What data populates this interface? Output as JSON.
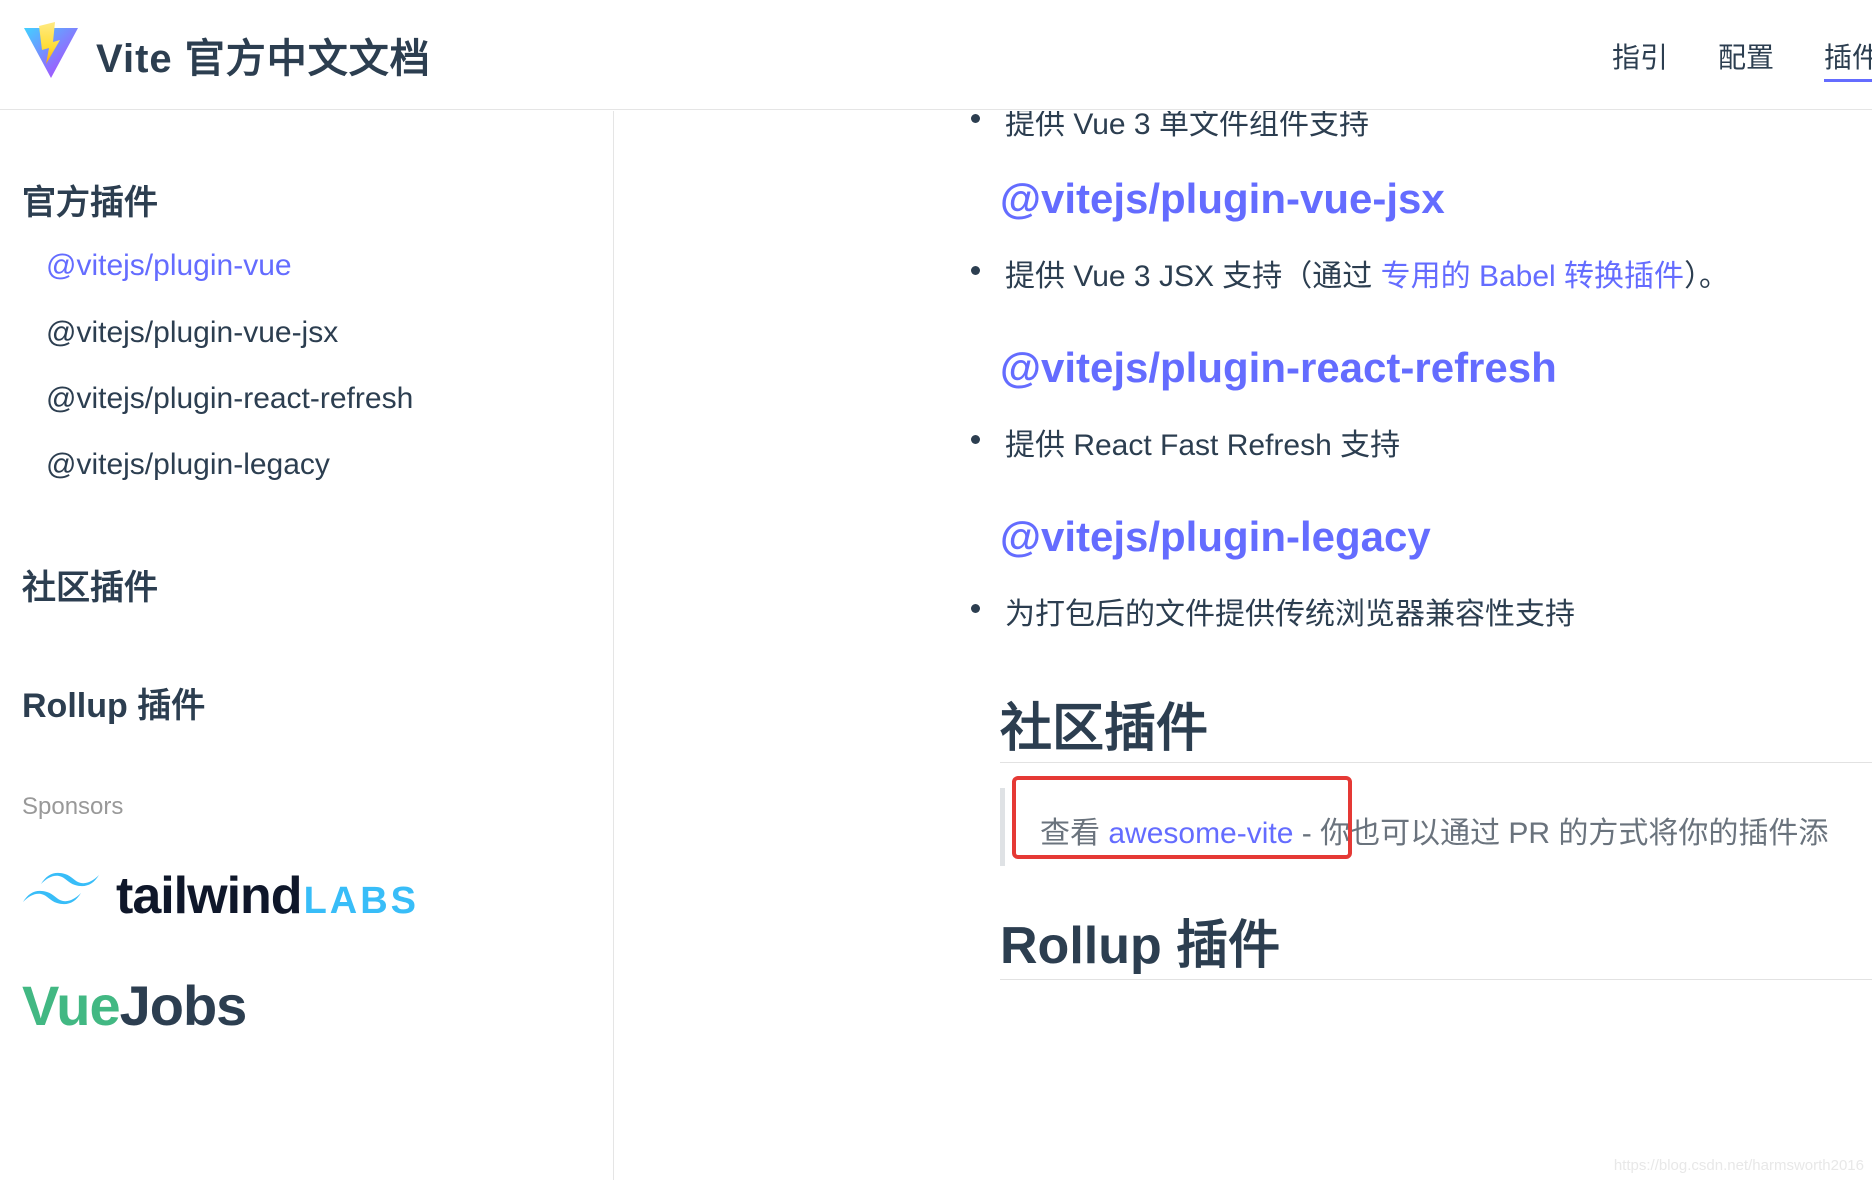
{
  "header": {
    "site_title": "Vite 官方中文文档",
    "nav": [
      "指引",
      "配置",
      "插件"
    ]
  },
  "sidebar": {
    "groups": [
      {
        "title": "官方插件"
      },
      {
        "title": "社区插件"
      },
      {
        "title": "Rollup 插件"
      }
    ],
    "items": [
      {
        "label": "@vitejs/plugin-vue",
        "active": true
      },
      {
        "label": "@vitejs/plugin-vue-jsx"
      },
      {
        "label": "@vitejs/plugin-react-refresh"
      },
      {
        "label": "@vitejs/plugin-legacy"
      }
    ],
    "sponsors_label": "Sponsors",
    "sponsor_logos": {
      "tailwind_word": "tailwind",
      "tailwind_labs": "LABS",
      "vuejobs_vue": "Vue",
      "vuejobs_jobs": "Jobs"
    }
  },
  "content": {
    "partial_bullet": "提供 Vue 3 单文件组件支持",
    "sections": [
      {
        "title": "@vitejs/plugin-vue-jsx",
        "bullet_prefix": "提供 Vue 3 JSX 支持（通过 ",
        "bullet_link": "专用的 Babel 转换插件",
        "bullet_suffix": "）。"
      },
      {
        "title": "@vitejs/plugin-react-refresh",
        "bullet": "提供 React Fast Refresh 支持"
      },
      {
        "title": "@vitejs/plugin-legacy",
        "bullet": "为打包后的文件提供传统浏览器兼容性支持"
      }
    ],
    "community": {
      "title": "社区插件",
      "tip_prefix": "查看 ",
      "tip_link": "awesome-vite",
      "tip_suffix": " - 你也可以通过 PR 的方式将你的插件添"
    },
    "rollup": {
      "title": "Rollup 插件"
    }
  },
  "watermark": "https://blog.csdn.net/harmsworth2016",
  "colors": {
    "accent": "#646cff",
    "text": "#2c3e50",
    "highlight": "#e53935"
  }
}
